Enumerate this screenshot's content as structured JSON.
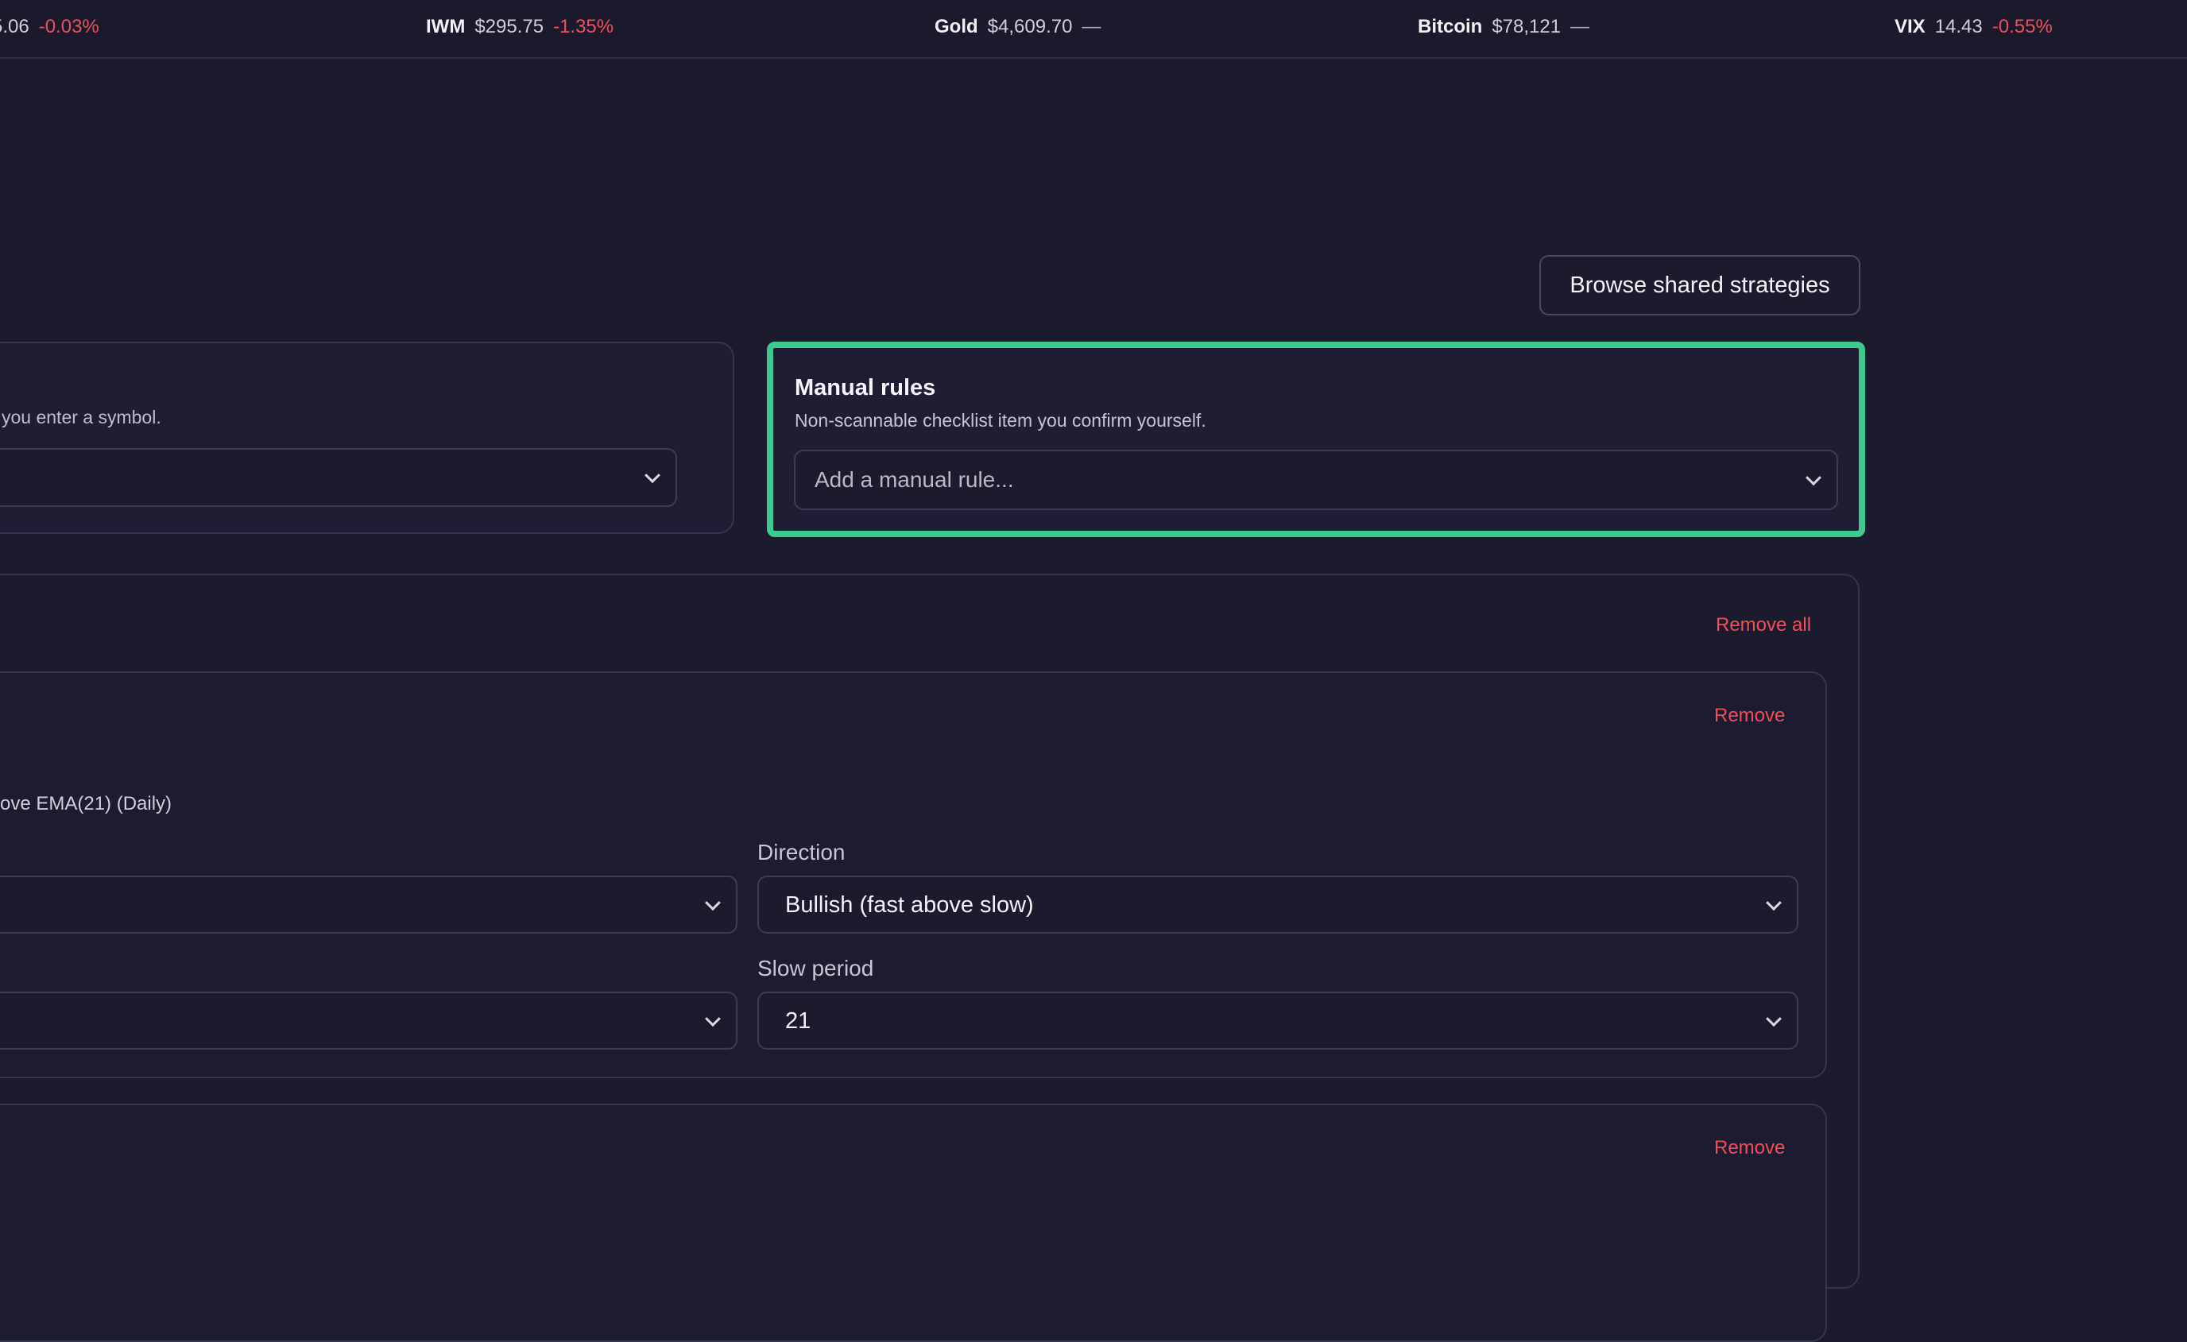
{
  "ticker": [
    {
      "symbol": "",
      "price": "5.06",
      "change": "-0.03%"
    },
    {
      "symbol": "IWM",
      "price": "$295.75",
      "change": "-1.35%"
    },
    {
      "symbol": "Gold",
      "price": "$4,609.70",
      "change": "—"
    },
    {
      "symbol": "Bitcoin",
      "price": "$78,121",
      "change": "—"
    },
    {
      "symbol": "VIX",
      "price": "14.43",
      "change": "-0.55%"
    }
  ],
  "header": {
    "browse_label": "Browse shared strategies"
  },
  "scan_rules": {
    "hint": "you enter a symbol."
  },
  "manual_rules": {
    "title": "Manual rules",
    "description": "Non-scannable checklist item you confirm yourself.",
    "placeholder": "Add a manual rule..."
  },
  "rules_list": {
    "remove_all_label": "Remove all",
    "rule1": {
      "remove_label": "Remove",
      "summary": "ove EMA(21) (Daily)",
      "direction_label": "Direction",
      "direction_value": "Bullish (fast above slow)",
      "slow_period_label": "Slow period",
      "slow_period_value": "21"
    },
    "rule2": {
      "remove_label": "Remove"
    }
  },
  "colors": {
    "accent": "#3fc98f",
    "negative": "#ef4f5b",
    "background": "#1c1b2e"
  }
}
